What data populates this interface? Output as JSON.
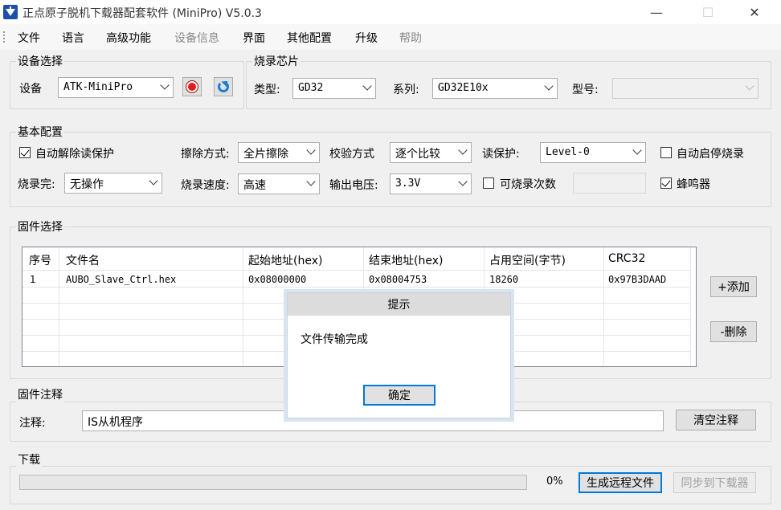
{
  "window": {
    "title": "正点原子脱机下载器配套软件 (MiniPro)  V5.0.3",
    "minimize": "—",
    "maximize": "☐",
    "close": "✕"
  },
  "menu": [
    "文件",
    "语言",
    "高级功能",
    "设备信息",
    "界面",
    "其他配置",
    "升级",
    "帮助"
  ],
  "device_group": {
    "title": "设备选择",
    "device_label": "设备",
    "device_value": "ATK-MiniPro"
  },
  "chip_group": {
    "title": "烧录芯片",
    "type_label": "类型:",
    "type_value": "GD32",
    "series_label": "系列:",
    "series_value": "GD32E10x",
    "model_label": "型号:",
    "model_value": ""
  },
  "basic_config": {
    "title": "基本配置",
    "auto_unprotect_label": "自动解除读保护",
    "auto_unprotect_checked": true,
    "erase_label": "擦除方式:",
    "erase_value": "全片擦除",
    "verify_label": "校验方式",
    "verify_value": "逐个比较",
    "read_protect_label": "读保护:",
    "read_protect_value": "Level-0",
    "auto_start_stop_label": "自动启停烧录",
    "auto_start_stop_checked": false,
    "after_burn_label": "烧录完:",
    "after_burn_value": "无操作",
    "speed_label": "烧录速度:",
    "speed_value": "高速",
    "voltage_label": "输出电压:",
    "voltage_value": "3.3V",
    "burn_count_label": "可烧录次数",
    "burn_count_checked": false,
    "burn_count_value": "",
    "buzzer_label": "蜂鸣器",
    "buzzer_checked": true
  },
  "firmware": {
    "title": "固件选择",
    "columns": [
      "序号",
      "文件名",
      "起始地址(hex)",
      "结束地址(hex)",
      "占用空间(字节)",
      "CRC32"
    ],
    "rows": [
      [
        "1",
        "AUBO_Slave_Ctrl.hex",
        "0x08000000",
        "0x08004753",
        "18260",
        "0x97B3DAAD"
      ]
    ],
    "add_button": "+添加",
    "delete_button": "-删除"
  },
  "comment": {
    "title": "固件注释",
    "label": "注释:",
    "value": "IS从机程序",
    "clear_button": "清空注释"
  },
  "download": {
    "title": "下载",
    "progress_percent": 0,
    "progress_text": "0%",
    "generate_button": "生成远程文件",
    "sync_button": "同步到下载器"
  },
  "dialog": {
    "title": "提示",
    "message": "文件传输完成",
    "ok_button": "确定"
  },
  "colors": {
    "accent": "#0078d7",
    "record_red": "#e21a1a",
    "refresh_blue": "#1b7fd6"
  }
}
